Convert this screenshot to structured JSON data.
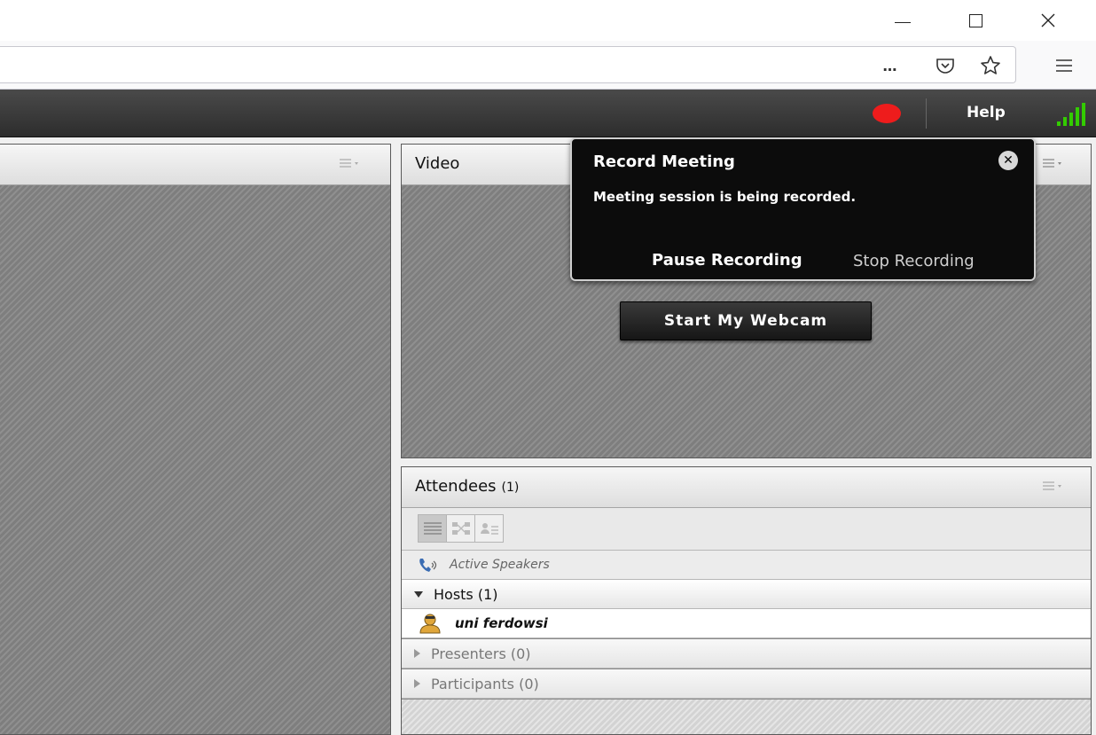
{
  "browser": {
    "overflow_icon": "…"
  },
  "meeting": {
    "help_label": "Help"
  },
  "video_pod": {
    "title": "Video",
    "webcam_button": "Start My Webcam"
  },
  "attendees_pod": {
    "title": "Attendees",
    "count": "(1)",
    "active_speakers": "Active Speakers",
    "groups": [
      {
        "label": "Hosts (1)",
        "expanded": true
      },
      {
        "label": "Presenters (0)",
        "expanded": false
      },
      {
        "label": "Participants (0)",
        "expanded": false
      }
    ],
    "host_user": "uni ferdowsi"
  },
  "record_popup": {
    "title": "Record Meeting",
    "message": "Meeting session is being recorded.",
    "pause_label": "Pause Recording",
    "stop_label": "Stop Recording"
  },
  "colors": {
    "record_red": "#ee1c1c",
    "signal_green": "#33cc00",
    "header_dark": "#2d2d2d"
  },
  "icons": {
    "menu": "pod-menu-icon",
    "phone": "phone-speaker-icon",
    "host": "host-user-icon"
  }
}
